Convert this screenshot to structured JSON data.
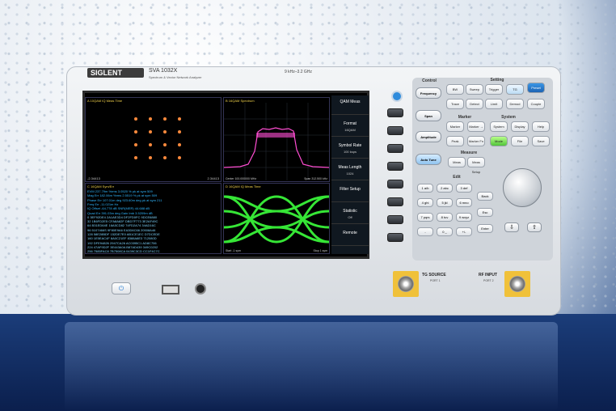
{
  "brand": {
    "logo": "SIGLENT",
    "model": "SVA 1032X",
    "subtitle": "Spectrum & Vector Network Analyzer",
    "freq_range": "9 kHz–3.2 GHz"
  },
  "screen": {
    "panes": {
      "a": "A  10QAM  IQ Meas Time",
      "b": "B  16QAM  Spectrum",
      "c": "C  16QAM  Sym/Err",
      "d": "D  16QAM  IQ Meas Time"
    },
    "axes": {
      "a_left": "-2.34413",
      "a_right": "2.34413",
      "b_center": "Center 100.000000 MHz",
      "b_span": "Span 312.500 kHz",
      "d_start": "Start -1 sym",
      "d_stop": "Stop 1 sym"
    },
    "table_rows": [
      "EVM        237.79m   %rms 3.0520   % pk at sym   509",
      "Mag Err    182.06m   %rms 2.5519   % pk at sym   509",
      "Phase Err  107.01m   deg 923.60m   deg pk at sym 211",
      "Freq Err   -11.021m  Hz",
      "IQ Offset  -64.778   dB   SNR(MER)  44.688   dB",
      "Quad Err   391.03m   deg  Gain Imb  3.5209m  dB",
      "0  3EF92DE4 2A1AE3D4 DF2FD0FC 9DCE6880",
      "32 1B6FD2E5 CFA8A82F DBD7F773 3E2AF49C",
      "64 B31ED64E 16A5CD82 74FD2A74 34AD16C",
      "96 5107466S 9F80E9A6 EA3D6C66 20508A46",
      "128 58E28BDF 152DE7E0 AB1CE1EC D7DCEDE",
      "160 1E5EAC4F 8A0C21EF 8388A8E3 712080D",
      "192 DFE94826 2947CA26 AC0395C1 AD8C706",
      "224 47AF9D2F 3E443A0A B87AD439 349C0202",
      "256 7585FAC8 7B7508CA 0439C3CD CC1F4C7C"
    ]
  },
  "softkeys": [
    {
      "title": "QAM Meas",
      "value": ""
    },
    {
      "title": "Format",
      "value": "16QAM"
    },
    {
      "title": "Symbol Rate",
      "value": "100 ksps"
    },
    {
      "title": "Meas Length",
      "value": "1024"
    },
    {
      "title": "Filter Setup",
      "value": ""
    },
    {
      "title": "Statistic",
      "value": "Off"
    },
    {
      "title": "Remote",
      "value": ""
    }
  ],
  "panel": {
    "sections": {
      "control": "Control",
      "setting": "Setting",
      "marker": "Marker",
      "system": "System",
      "measure": "Measure",
      "edit": "Edit"
    },
    "control": [
      "Frequency",
      "Span",
      "Amplitude",
      "Auto Tune"
    ],
    "setting": [
      "BW",
      "Sweep",
      "Trigger",
      "TG",
      "Preset",
      "Trace",
      "Detect",
      "Limit",
      "Demod",
      "Couple"
    ],
    "marker": [
      "Marker",
      "Marker →",
      "Peak",
      "Marker Fn"
    ],
    "system": [
      "System",
      "Display",
      "Help",
      "Mode",
      "File",
      "Save"
    ],
    "measure": [
      "Meas",
      "Meas Setup"
    ],
    "keypad": [
      "1 a/b",
      "2 abc",
      "3 def",
      "Back",
      "4 ghi",
      "5 jkl",
      "6 mno",
      "Esc",
      "7 pqrs",
      "8 tuv",
      "9 wxyz",
      "Enter",
      "-",
      "0 _",
      "+/-"
    ]
  },
  "ports": {
    "tg_title": "TG SOURCE",
    "tg_sub": "PORT 1",
    "rf_title": "RF INPUT",
    "rf_sub": "PORT 2"
  }
}
